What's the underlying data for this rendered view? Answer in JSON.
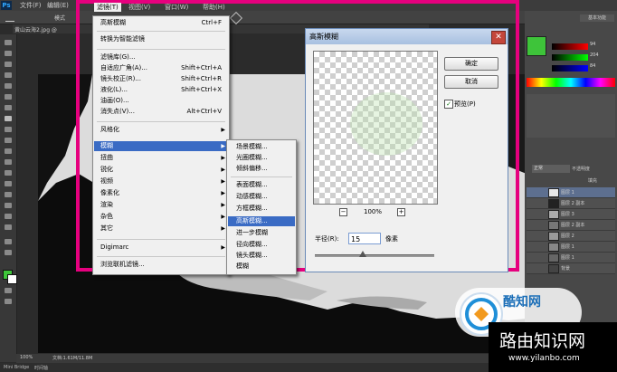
{
  "app": {
    "logo": "Ps",
    "menus": [
      "文件(F)",
      "编辑(E)",
      "滤镜(T)",
      "视图(V)",
      "窗口(W)",
      "帮助(H)"
    ],
    "options_label": "模式",
    "doc_tab": "黄山云海2.jpg @"
  },
  "filter_menu": {
    "items": [
      {
        "label": "高斯模糊",
        "shortcut": "Ctrl+F"
      },
      {
        "label": "转换为智能滤镜",
        "shortcut": ""
      },
      {
        "label": "滤镜库(G)...",
        "shortcut": ""
      },
      {
        "label": "自适应广角(A)...",
        "shortcut": "Shift+Ctrl+A"
      },
      {
        "label": "镜头校正(R)...",
        "shortcut": "Shift+Ctrl+R"
      },
      {
        "label": "液化(L)...",
        "shortcut": "Shift+Ctrl+X"
      },
      {
        "label": "油画(O)...",
        "shortcut": ""
      },
      {
        "label": "消失点(V)...",
        "shortcut": "Alt+Ctrl+V"
      },
      {
        "label": "风格化",
        "shortcut": ""
      },
      {
        "label": "模糊",
        "shortcut": ""
      },
      {
        "label": "扭曲",
        "shortcut": ""
      },
      {
        "label": "锐化",
        "shortcut": ""
      },
      {
        "label": "视频",
        "shortcut": ""
      },
      {
        "label": "像素化",
        "shortcut": ""
      },
      {
        "label": "渲染",
        "shortcut": ""
      },
      {
        "label": "杂色",
        "shortcut": ""
      },
      {
        "label": "其它",
        "shortcut": ""
      },
      {
        "label": "Digimarc",
        "shortcut": ""
      },
      {
        "label": "浏览联机滤镜...",
        "shortcut": ""
      }
    ]
  },
  "blur_menu": {
    "items": [
      "场景模糊...",
      "光圈模糊...",
      "倾斜偏移...",
      "表面模糊...",
      "动感模糊...",
      "方框模糊...",
      "高斯模糊...",
      "进一步模糊",
      "径向模糊...",
      "镜头模糊...",
      "模糊"
    ]
  },
  "dialog": {
    "title": "高斯模糊",
    "ok": "确定",
    "cancel": "取消",
    "preview_label": "预览(P)",
    "preview_checked": true,
    "zoom": "100%",
    "zoom_minus": "−",
    "zoom_plus": "+",
    "radius_label": "半径(R):",
    "radius_value": "15",
    "radius_unit": "像素",
    "radius_fraction": 0.4
  },
  "panels": {
    "layer_names": [
      "图层 1",
      "图层 2 副本",
      "图层 3",
      "图层 2 副本",
      "图层 2",
      "图层 1",
      "图层 1",
      "背景"
    ],
    "blend_mode": "正常",
    "opacity_label": "不透明度",
    "fill_label": "填充",
    "color_values": [
      "94",
      "204",
      "84"
    ],
    "tab_essentials": "基本功能"
  },
  "status": {
    "zoom": "100%",
    "doc": "文档:1.61M/11.8M",
    "tabs": [
      "Mini Bridge",
      "时间轴"
    ]
  },
  "watermark": {
    "logo_text": "酷知网",
    "site_name": "路由知识网",
    "site_url": "www.yilanbo.com"
  },
  "colors": {
    "frame": "#e6007e",
    "highlight": "#3a6bc4",
    "foreground": "#3ec43a"
  }
}
